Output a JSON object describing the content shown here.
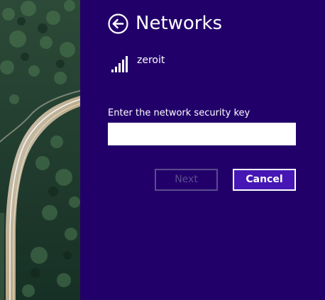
{
  "panel": {
    "title": "Networks",
    "back_icon": "back-arrow-circle-icon"
  },
  "network": {
    "name": "zeroit",
    "signal_icon": "wifi-signal-bars-icon",
    "signal_level": 5
  },
  "security_key": {
    "label": "Enter the network security key",
    "value": "",
    "placeholder": ""
  },
  "buttons": {
    "next_label": "Next",
    "cancel_label": "Cancel"
  },
  "colors": {
    "panel_background": "#22006a",
    "cancel_background": "#4617b4",
    "disabled_text": "#5b4c8e",
    "text": "#ffffff"
  }
}
